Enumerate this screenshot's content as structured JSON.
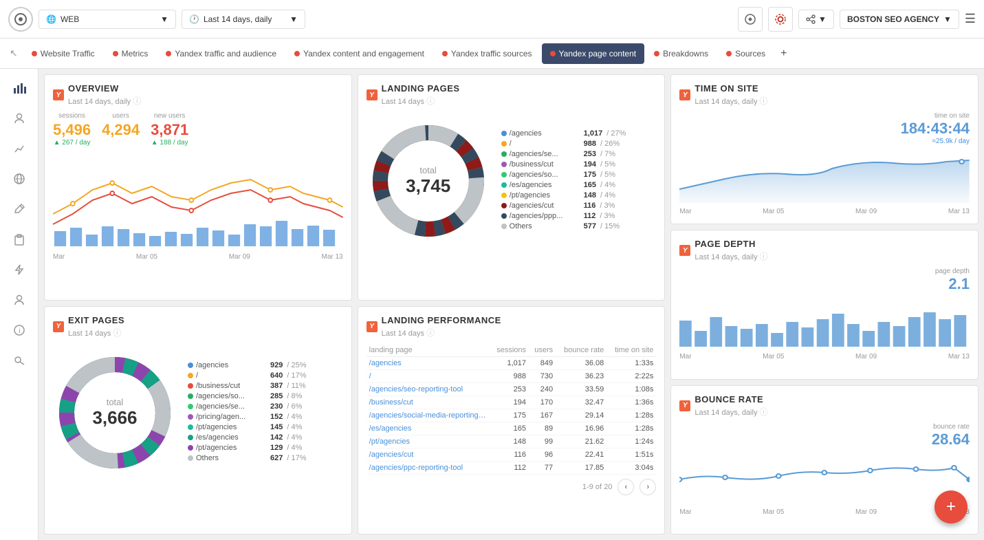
{
  "topbar": {
    "logo": "◎",
    "web_label": "WEB",
    "date_label": "Last 14 days, daily",
    "agency_label": "BOSTON SEO AGENCY",
    "web_arrow": "▼",
    "date_arrow": "▼",
    "agency_arrow": "▼"
  },
  "nav": {
    "back_icon": "↖",
    "tabs": [
      {
        "label": "Website Traffic",
        "dot_color": "#e74c3c",
        "active": false
      },
      {
        "label": "Metrics",
        "dot_color": "#e74c3c",
        "active": false
      },
      {
        "label": "Yandex traffic and audience",
        "dot_color": "#e74c3c",
        "active": false
      },
      {
        "label": "Yandex content and engagement",
        "dot_color": "#e74c3c",
        "active": false
      },
      {
        "label": "Yandex traffic sources",
        "dot_color": "#e74c3c",
        "active": false
      },
      {
        "label": "Yandex page content",
        "dot_color": "#e74c3c",
        "active": true
      },
      {
        "label": "Breakdowns",
        "dot_color": "#e74c3c",
        "active": false
      },
      {
        "label": "Sources",
        "dot_color": "#e74c3c",
        "active": false
      }
    ],
    "add_label": "+"
  },
  "overview": {
    "title": "OVERVIEW",
    "subtitle": "Last 14 days, daily",
    "sessions_label": "sessions",
    "sessions_value": "5,496",
    "sessions_change": "267 / day",
    "users_label": "users",
    "users_value": "4,294",
    "new_users_label": "new users",
    "new_users_value": "3,871",
    "new_users_change": "188 / day",
    "chart_labels": [
      "Mar",
      "Mar 05",
      "Mar 09",
      "Mar 13"
    ]
  },
  "landing_pages": {
    "title": "LANDING PAGES",
    "subtitle": "Last 14 days",
    "total_label": "total",
    "total_value": "3,745",
    "items": [
      {
        "label": "/agencies",
        "value": "1,017",
        "pct": "27%",
        "color": "#4a90d9"
      },
      {
        "label": "/",
        "value": "988",
        "pct": "26%",
        "color": "#f5a623"
      },
      {
        "label": "/agencies/se...",
        "value": "253",
        "pct": "7%",
        "color": "#27ae60"
      },
      {
        "label": "/business/cut",
        "value": "194",
        "pct": "5%",
        "color": "#9b59b6"
      },
      {
        "label": "/agencies/so...",
        "value": "175",
        "pct": "5%",
        "color": "#2ecc71"
      },
      {
        "label": "/es/agencies",
        "value": "165",
        "pct": "4%",
        "color": "#1abc9c"
      },
      {
        "label": "/pt/agencies",
        "value": "148",
        "pct": "4%",
        "color": "#f1c40f"
      },
      {
        "label": "/agencies/cut",
        "value": "116",
        "pct": "3%",
        "color": "#8e1a1a"
      },
      {
        "label": "/agencies/ppp...",
        "value": "112",
        "pct": "3%",
        "color": "#34495e"
      },
      {
        "label": "Others",
        "value": "577",
        "pct": "15%",
        "color": "#bdc3c7"
      }
    ]
  },
  "time_on_site": {
    "title": "TIME ON SITE",
    "subtitle": "Last 14 days, daily",
    "value_label": "time on site",
    "value": "184:43:44",
    "sub_label": "≈25.9k / day",
    "chart_labels": [
      "Mar",
      "Mar 05",
      "Mar 09",
      "Mar 13"
    ]
  },
  "page_depth": {
    "title": "PAGE DEPTH",
    "subtitle": "Last 14 days, daily",
    "value_label": "page depth",
    "value": "2.1",
    "chart_labels": [
      "Mar",
      "Mar 05",
      "Mar 09",
      "Mar 13"
    ]
  },
  "bounce_rate": {
    "title": "BOUNCE RATE",
    "subtitle": "Last 14 days, daily",
    "value_label": "bounce rate",
    "value": "28.64",
    "chart_labels": [
      "Mar",
      "Mar 05",
      "Mar 09",
      "Mar 13"
    ]
  },
  "exit_pages": {
    "title": "EXIT PAGES",
    "subtitle": "Last 14 days",
    "total_label": "total",
    "total_value": "3,666",
    "items": [
      {
        "label": "/agencies",
        "value": "929",
        "pct": "25%",
        "color": "#4a90d9"
      },
      {
        "label": "/",
        "value": "640",
        "pct": "17%",
        "color": "#f5a623"
      },
      {
        "label": "/business/cut",
        "value": "387",
        "pct": "11%",
        "color": "#e74c3c"
      },
      {
        "label": "/agencies/so...",
        "value": "285",
        "pct": "8%",
        "color": "#27ae60"
      },
      {
        "label": "/agencies/se...",
        "value": "230",
        "pct": "6%",
        "color": "#2ecc71"
      },
      {
        "label": "/pricing/agen...",
        "value": "152",
        "pct": "4%",
        "color": "#9b59b6"
      },
      {
        "label": "/pt/agencies",
        "value": "145",
        "pct": "4%",
        "color": "#1abc9c"
      },
      {
        "label": "/es/agencies",
        "value": "142",
        "pct": "4%",
        "color": "#16a085"
      },
      {
        "label": "/pt/agencies",
        "value": "129",
        "pct": "4%",
        "color": "#8e44ad"
      },
      {
        "label": "Others",
        "value": "627",
        "pct": "17%",
        "color": "#bdc3c7"
      }
    ]
  },
  "landing_perf": {
    "title": "LANDING PERFORMANCE",
    "subtitle": "Last 14 days",
    "col_landing": "landing page",
    "col_sessions": "sessions",
    "col_users": "users",
    "col_bounce": "bounce rate",
    "col_time": "time on site",
    "rows": [
      {
        "page": "/agencies",
        "sessions": "1,017",
        "users": "849",
        "bounce": "36.08",
        "time": "1:33s"
      },
      {
        "page": "/",
        "sessions": "988",
        "users": "730",
        "bounce": "36.23",
        "time": "2:22s"
      },
      {
        "page": "/agencies/seo-reporting-tool",
        "sessions": "253",
        "users": "240",
        "bounce": "33.59",
        "time": "1:08s"
      },
      {
        "page": "/business/cut",
        "sessions": "194",
        "users": "170",
        "bounce": "32.47",
        "time": "1:36s"
      },
      {
        "page": "/agencies/social-media-reporting-too...",
        "sessions": "175",
        "users": "167",
        "bounce": "29.14",
        "time": "1:28s"
      },
      {
        "page": "/es/agencies",
        "sessions": "165",
        "users": "89",
        "bounce": "16.96",
        "time": "1:28s"
      },
      {
        "page": "/pt/agencies",
        "sessions": "148",
        "users": "99",
        "bounce": "21.62",
        "time": "1:24s"
      },
      {
        "page": "/agencies/cut",
        "sessions": "116",
        "users": "96",
        "bounce": "22.41",
        "time": "1:51s"
      },
      {
        "page": "/agencies/ppc-reporting-tool",
        "sessions": "112",
        "users": "77",
        "bounce": "17.85",
        "time": "3:04s"
      }
    ],
    "pagination": "1-9 of 20"
  },
  "fab": {
    "label": "+"
  },
  "sidebar_icons": [
    "◎",
    "👤",
    "⚡",
    "🌐",
    "✏",
    "📋",
    "💡",
    "👤",
    "ℹ",
    "🔑"
  ]
}
